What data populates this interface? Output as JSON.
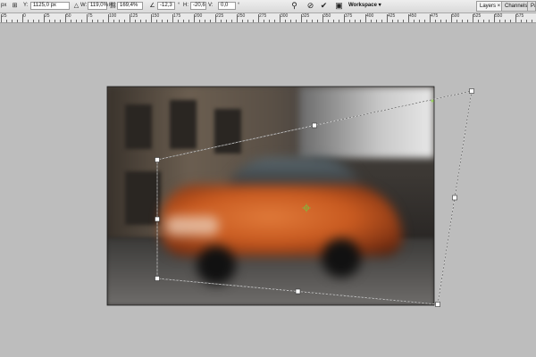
{
  "options_bar": {
    "x_value": "px",
    "y_label": "Y:",
    "y_value": "1125,0 px",
    "w_label": "W:",
    "w_value": "119,0%",
    "h_label": "H:",
    "h_value": "169,4%",
    "angle_value": "-12,3",
    "hskew_label": "H:",
    "hskew_value": "-20,6",
    "vskew_label": "V:",
    "vskew_value": "0,0",
    "workspace_label": "Workspace"
  },
  "panel_tabs": [
    {
      "label": "Layers ×"
    },
    {
      "label": "Channels"
    },
    {
      "label": "Pat"
    }
  ],
  "ruler": {
    "labels": [
      "25",
      "0",
      "25",
      "50",
      "75",
      "100",
      "125",
      "150",
      "175",
      "200",
      "225",
      "250",
      "275",
      "300",
      "325",
      "350",
      "375",
      "400",
      "425",
      "450",
      "475",
      "500",
      "525",
      "550",
      "575",
      "600"
    ]
  },
  "icons": {
    "reference": "reference-point-icon",
    "link": "link-icon",
    "angle": "angle-icon",
    "warp": "warp-icon",
    "cancel": "cancel-icon",
    "commit": "commit-icon",
    "camera": "camera-icon"
  },
  "colors": {
    "car": "#d06a2a",
    "canvas_bg": "#bdbdbd"
  }
}
